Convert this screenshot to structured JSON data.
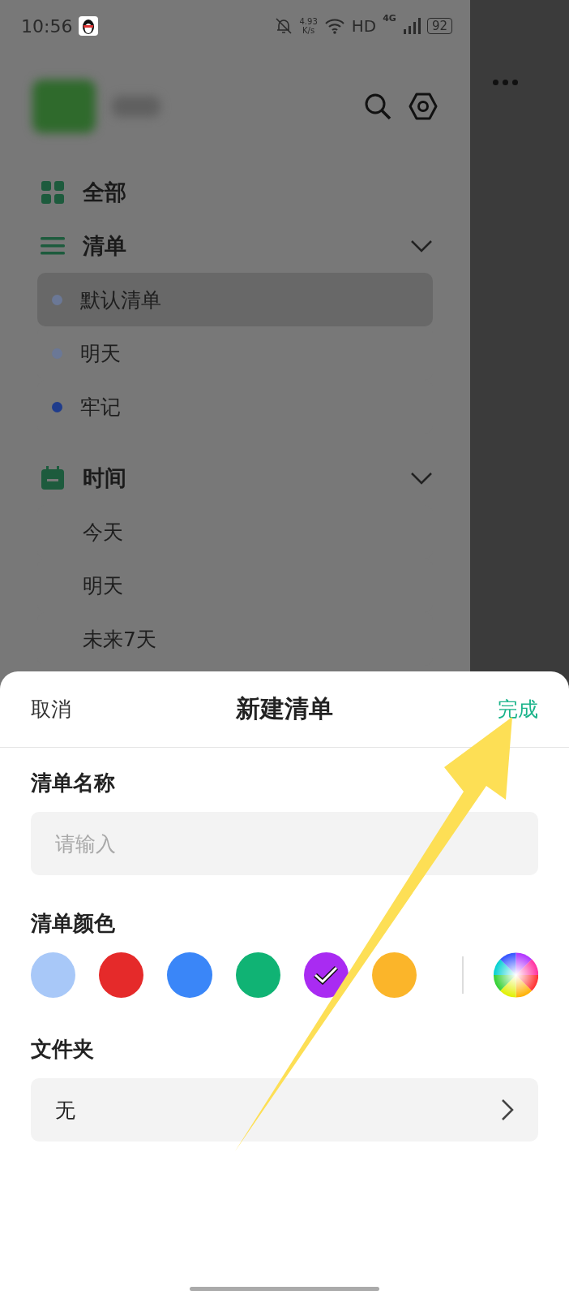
{
  "status_bar": {
    "time": "10:56",
    "speed_value": "4.93",
    "speed_unit": "K/s",
    "hd": "HD",
    "network": "4G",
    "battery": "92"
  },
  "drawer": {
    "items": [
      {
        "kind": "all",
        "label": "全部"
      },
      {
        "kind": "lists",
        "label": "清单",
        "expanded": true,
        "children": [
          {
            "label": "默认清单",
            "color": "#6b7896",
            "selected": true
          },
          {
            "label": "明天",
            "color": "#6b7896",
            "selected": false
          },
          {
            "label": "牢记",
            "color": "#1f3c8c",
            "selected": false
          }
        ]
      },
      {
        "kind": "time",
        "label": "时间",
        "expanded": true,
        "children": [
          {
            "label": "今天",
            "selected": false
          },
          {
            "label": "明天",
            "selected": false
          },
          {
            "label": "未来7天",
            "selected": false
          }
        ]
      }
    ]
  },
  "sheet": {
    "cancel": "取消",
    "title": "新建清单",
    "done": "完成",
    "name_label": "清单名称",
    "name_placeholder": "请输入",
    "color_label": "清单颜色",
    "colors": [
      {
        "color": "#a8c8f8",
        "selected": false
      },
      {
        "color": "#e52a2a",
        "selected": false
      },
      {
        "color": "#3a86f8",
        "selected": false
      },
      {
        "color": "#10b374",
        "selected": false
      },
      {
        "color": "#a92bf2",
        "selected": true
      },
      {
        "color": "#fbb52a",
        "selected": false
      }
    ],
    "folder_label": "文件夹",
    "folder_value": "无"
  }
}
